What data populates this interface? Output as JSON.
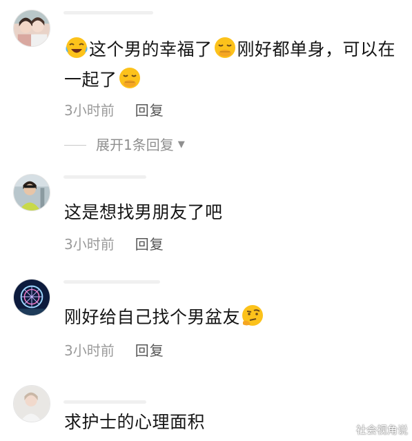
{
  "comments": [
    {
      "text_parts": [
        "这个男的幸福了",
        "刚好都单身，可以在",
        "一起了"
      ],
      "time": "3小时前",
      "reply_label": "回复",
      "emoji_names": [
        "tears-of-joy-emoji",
        "smirk-cover-mouth-emoji",
        "smirk-cover-mouth-emoji"
      ]
    },
    {
      "text": "这是想找男朋友了吧",
      "time": "3小时前",
      "reply_label": "回复"
    },
    {
      "text": "刚好给自己找个男盆友",
      "time": "3小时前",
      "reply_label": "回复",
      "emoji_names": [
        "thinking-emoji"
      ]
    },
    {
      "text": "求护士的心理面积"
    }
  ],
  "expand_replies": "展开1条回复",
  "watermark": "社会视角说",
  "colors": {
    "meta_text": "#9a9a9a",
    "reply_text": "#555555",
    "emoji_yellow": "#fcc21b"
  }
}
